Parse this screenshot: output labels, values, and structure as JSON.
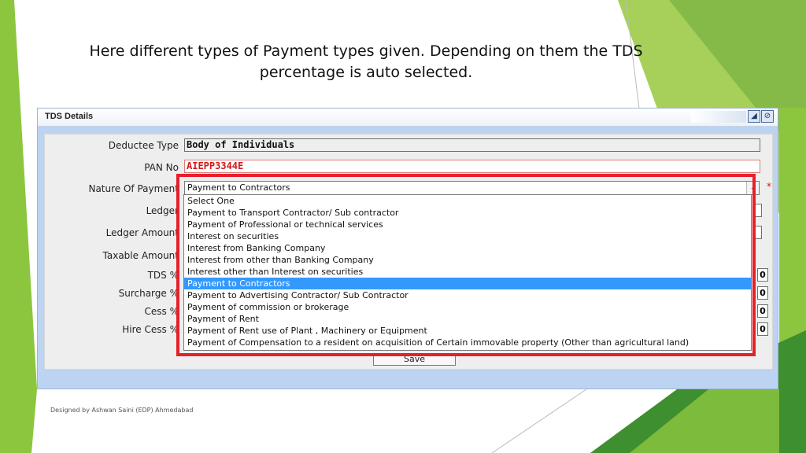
{
  "slide": {
    "caption_line1": "Here different types of Payment types given. Depending on them the TDS",
    "caption_line2": "percentage is auto selected.",
    "footer": "Designed by Ashwan Saini (EDP) Ahmedabad",
    "accent_color": "#8cc63f"
  },
  "window": {
    "title": "TDS Details",
    "buttons": [
      "restore-icon",
      "close-icon"
    ]
  },
  "form": {
    "deductee_type": {
      "label": "Deductee Type",
      "value": "Body of Individuals"
    },
    "pan_no": {
      "label": "PAN No",
      "value": "AIEPP3344E"
    },
    "nature_of_payment": {
      "label": "Nature Of Payment",
      "value": "Payment to Contractors",
      "required_mark": "*"
    },
    "ledger": {
      "label": "Ledger"
    },
    "ledger_amount": {
      "label": "Ledger Amount"
    },
    "taxable_amount": {
      "label": "Taxable Amount"
    },
    "tds_pct": {
      "label": "TDS %",
      "value": "0"
    },
    "surcharge_pct": {
      "label": "Surcharge %",
      "value": "0"
    },
    "cess_pct": {
      "label": "Cess %",
      "value": "0"
    },
    "hire_cess_pct": {
      "label": "Hire Cess %",
      "value": "0"
    },
    "save_label": "Save"
  },
  "dropdown": {
    "selected_index": 7,
    "options": [
      "Select One",
      "Payment to Transport Contractor/ Sub contractor",
      "Payment of Professional or technical services",
      "Interest on securities",
      "Interest from Banking Company",
      "Interest from other than Banking Company",
      "Interest other than Interest on securities",
      "Payment to Contractors",
      "Payment to Advertising Contractor/ Sub Contractor",
      "Payment of commission or brokerage",
      "Payment of Rent",
      "Payment of Rent use of Plant , Machinery or Equipment",
      "Payment of Compensation to a resident on acquisition of Certain immovable property (Other than agricultural land)"
    ],
    "highlight_color": "#e5202a",
    "selected_color": "#3399ff"
  }
}
